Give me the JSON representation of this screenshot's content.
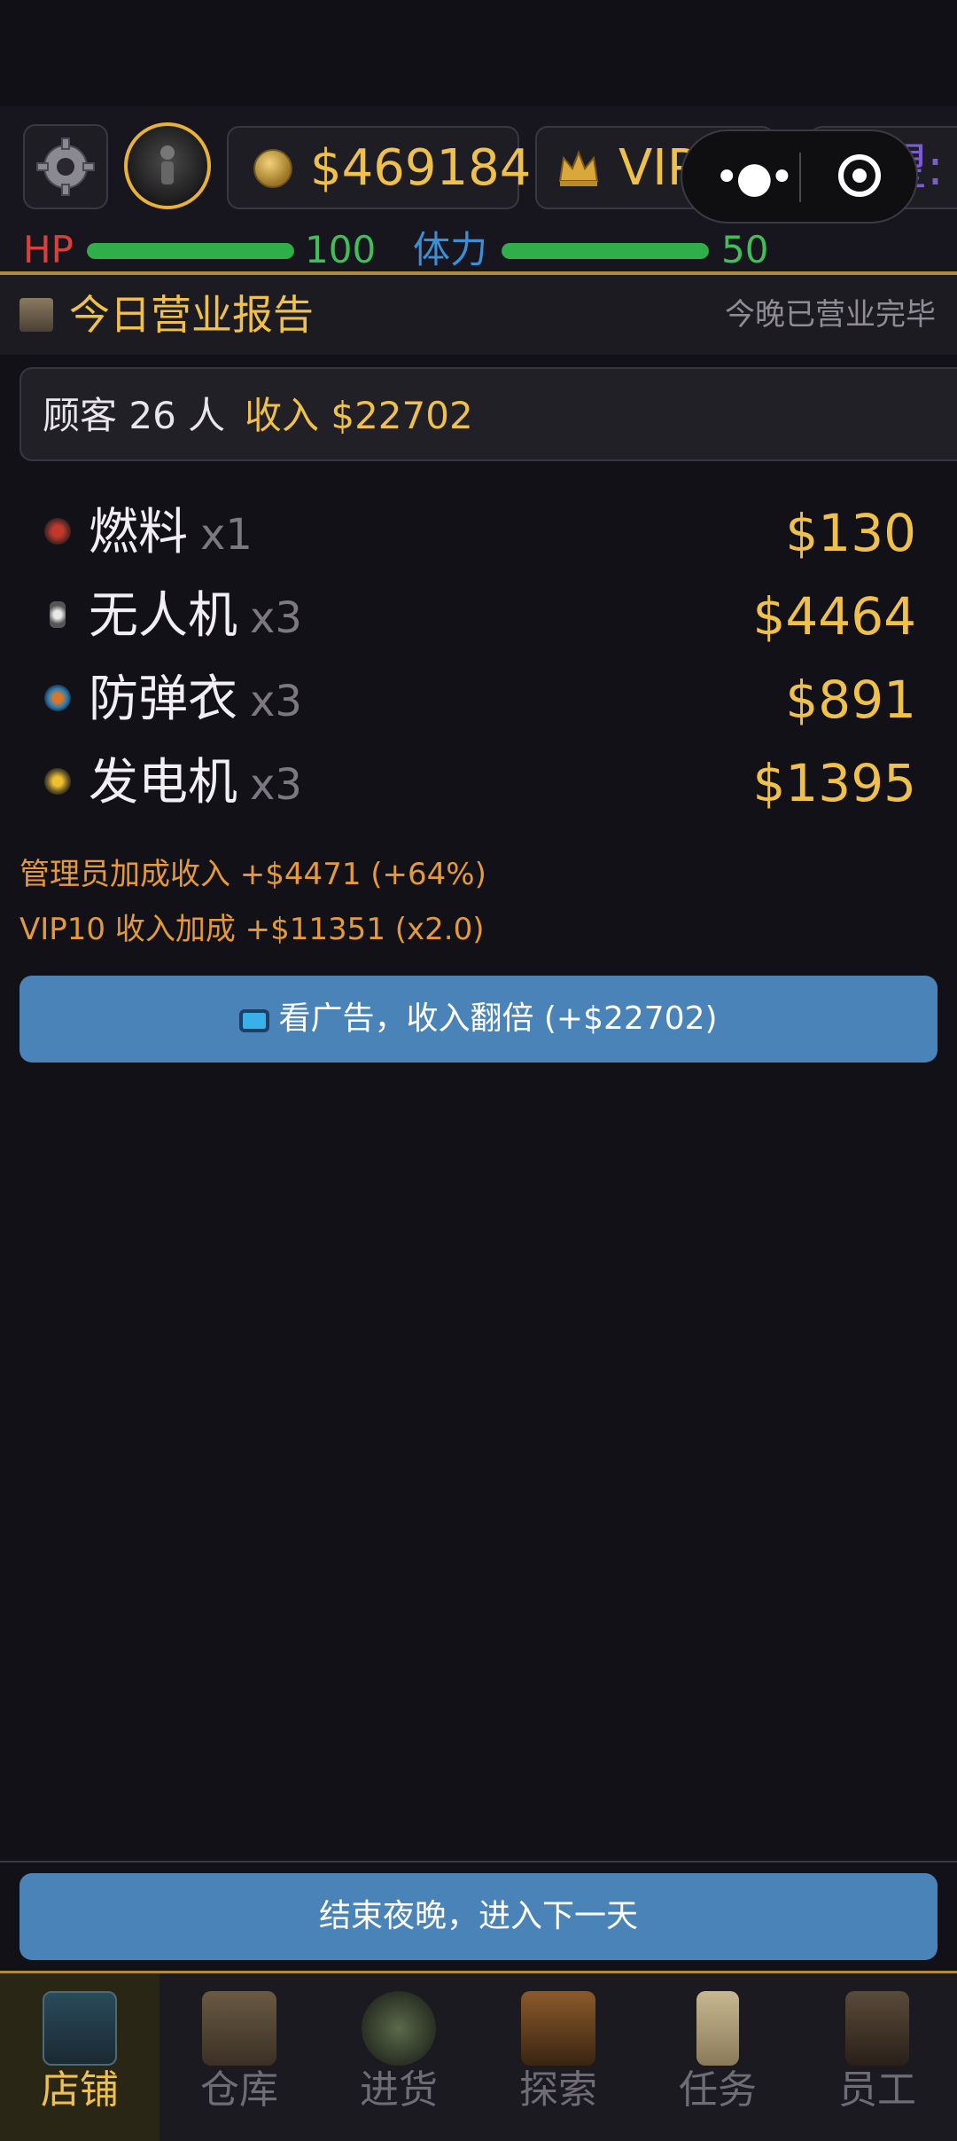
{
  "header": {
    "money": "$469184",
    "vip": "VIP 10",
    "reputation_label": "声望:"
  },
  "stats": {
    "hp_label": "HP",
    "hp_value": "100",
    "hp_fraction": 1.0,
    "stamina_label": "体力",
    "stamina_value": "50",
    "stamina_fraction": 1.0
  },
  "report": {
    "title": "今日营业报告",
    "status": "今晚已营业完毕",
    "customers": "顾客 26 人",
    "income": "收入 $22702",
    "items": [
      {
        "name": "燃料",
        "qty": "x1",
        "price": "$130",
        "icon": "fuel-icon"
      },
      {
        "name": "无人机",
        "qty": "x3",
        "price": "$4464",
        "icon": "drone-icon"
      },
      {
        "name": "防弹衣",
        "qty": "x3",
        "price": "$891",
        "icon": "armor-icon"
      },
      {
        "name": "发电机",
        "qty": "x3",
        "price": "$1395",
        "icon": "generator-icon"
      }
    ],
    "bonus_manager": "管理员加成收入 +$4471 (+64%)",
    "bonus_vip": "VIP10 收入加成 +$11351 (x2.0)"
  },
  "buttons": {
    "watch_ad": "看广告，收入翻倍 (+$22702)",
    "end_night": "结束夜晚，进入下一天"
  },
  "nav": [
    {
      "label": "店铺",
      "active": true
    },
    {
      "label": "仓库",
      "active": false
    },
    {
      "label": "进货",
      "active": false
    },
    {
      "label": "探索",
      "active": false
    },
    {
      "label": "任务",
      "active": false
    },
    {
      "label": "员工",
      "active": false
    }
  ],
  "colors": {
    "accent_gold": "#efc14a",
    "button_blue": "#4a83b8",
    "hp_red": "#d9403a",
    "stamina_blue": "#3a8fd6",
    "bar_green": "#2fae4a"
  }
}
